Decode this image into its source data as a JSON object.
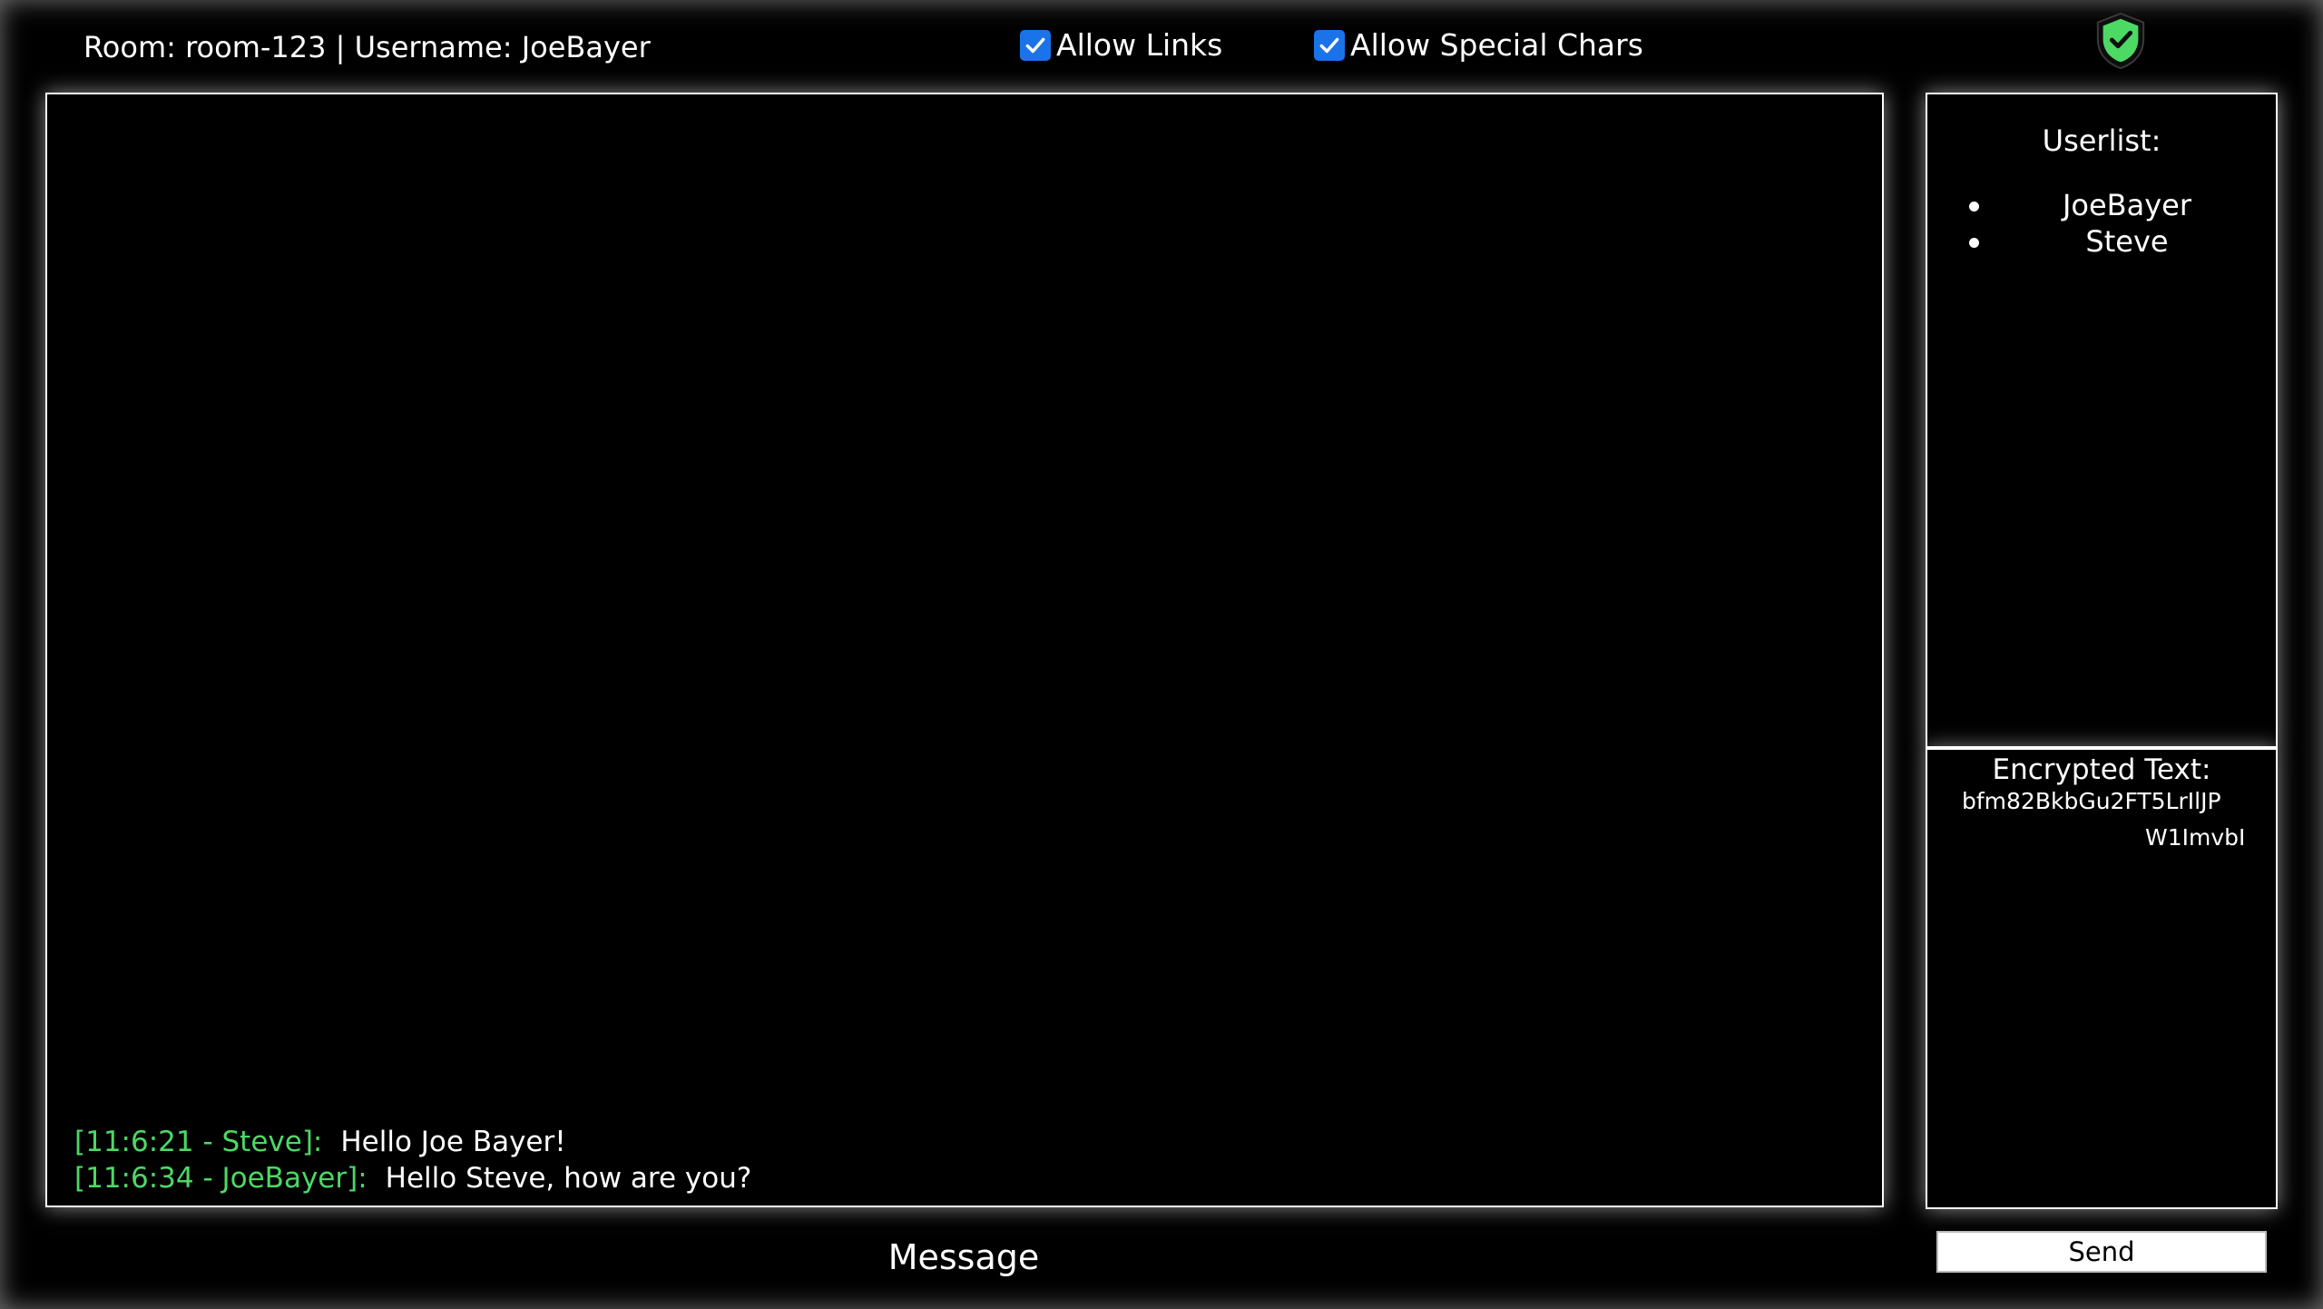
{
  "header": {
    "info": "Room: room-123 | Username: JoeBayer",
    "allow_links_label": "Allow Links",
    "allow_special_chars_label": "Allow Special Chars",
    "shield_icon": "shield-check-icon",
    "shield_color": "#4cd964"
  },
  "chat": {
    "messages": [
      {
        "meta": "[11:6:21 - Steve]:",
        "text": "Hello Joe Bayer!"
      },
      {
        "meta": "[11:6:34 - JoeBayer]:",
        "text": "Hello Steve, how are you?"
      }
    ]
  },
  "userlist": {
    "title": "Userlist:",
    "users": [
      "JoeBayer",
      "Steve"
    ]
  },
  "encrypted": {
    "title": "Encrypted Text:",
    "line1": "bfm82BkbGu2FT5LrIlJP",
    "line2": "W1ImvbI"
  },
  "composer": {
    "placeholder": "Message",
    "send_label": "Send"
  },
  "colors": {
    "accent": "#4cd964",
    "checkbox": "#1a73e8",
    "background": "#000000"
  }
}
